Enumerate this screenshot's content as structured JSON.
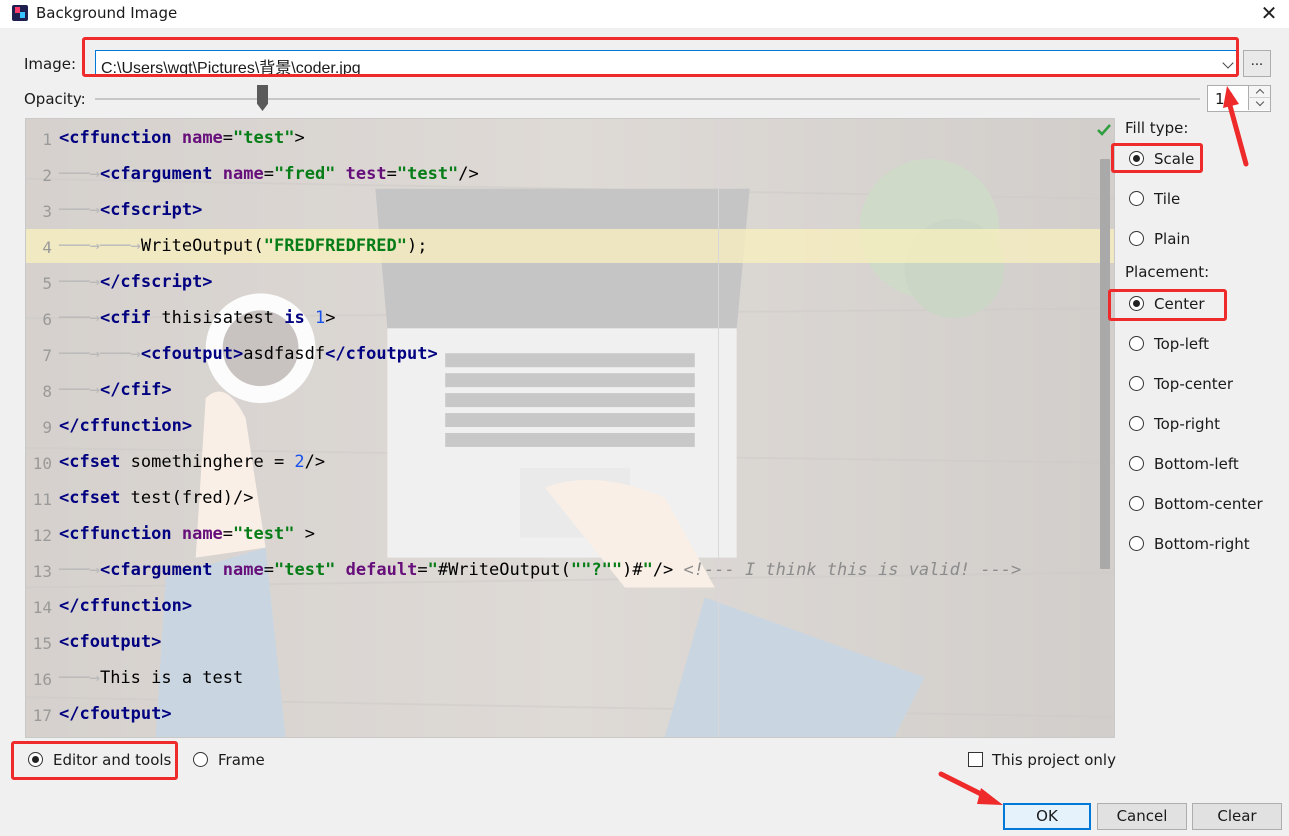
{
  "window": {
    "title": "Background Image"
  },
  "image": {
    "label": "Image:",
    "path": "C:\\Users\\wgt\\Pictures\\背景\\coder.jpg",
    "browse_label": "..."
  },
  "opacity": {
    "label": "Opacity:",
    "value": "15",
    "slider_fraction": 0.15
  },
  "preview": {
    "line_numbers": [
      "1",
      "2",
      "3",
      "4",
      "5",
      "6",
      "7",
      "8",
      "9",
      "10",
      "11",
      "12",
      "13",
      "14",
      "15",
      "16",
      "17"
    ],
    "highlight_color": "#faf0be"
  },
  "fill_type": {
    "label": "Fill type:",
    "options": [
      "Scale",
      "Tile",
      "Plain"
    ],
    "selected": "Scale"
  },
  "placement": {
    "label": "Placement:",
    "options": [
      "Center",
      "Top-left",
      "Top-center",
      "Top-right",
      "Bottom-left",
      "Bottom-center",
      "Bottom-right"
    ],
    "selected": "Center"
  },
  "target": {
    "options": [
      "Editor and tools",
      "Frame"
    ],
    "selected": "Editor and tools"
  },
  "project_only": {
    "label": "This project only",
    "checked": false
  },
  "buttons": {
    "ok": "OK",
    "cancel": "Cancel",
    "clear": "Clear"
  },
  "colors": {
    "annotation_red": "#ee2a2a",
    "focus_blue": "#0078d7",
    "tag": "#000080",
    "attr": "#660e7a",
    "string": "#067d17",
    "number": "#1750eb"
  }
}
